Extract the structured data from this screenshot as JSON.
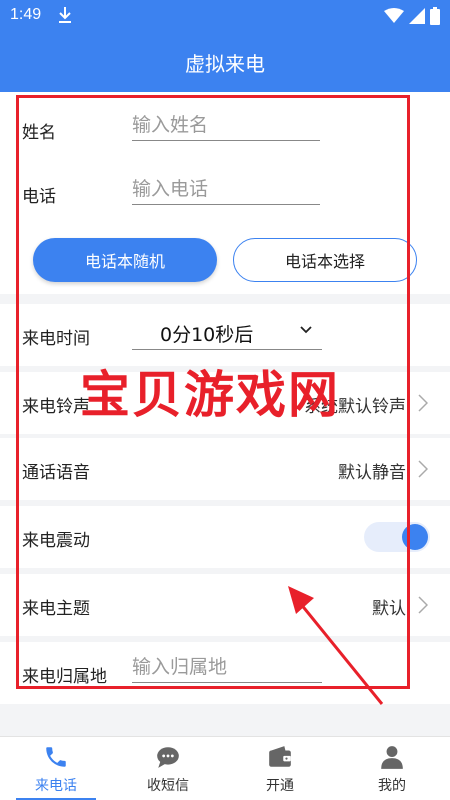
{
  "status": {
    "time": "1:49",
    "icons": [
      "download-icon",
      "wifi-icon",
      "signal-icon",
      "battery-icon"
    ]
  },
  "header": {
    "title": "虚拟来电"
  },
  "form": {
    "name": {
      "label": "姓名",
      "placeholder": "输入姓名"
    },
    "phone": {
      "label": "电话",
      "placeholder": "输入电话"
    },
    "buttons": {
      "random": "电话本随机",
      "choose": "电话本选择"
    },
    "call_time": {
      "label": "来电时间",
      "value": "0分10秒后"
    },
    "ringtone": {
      "label": "来电铃声",
      "value": "系统默认铃声"
    },
    "voice": {
      "label": "通话语音",
      "value": "默认静音"
    },
    "vibrate": {
      "label": "来电震动",
      "on": true
    },
    "theme": {
      "label": "来电主题",
      "value": "默认"
    },
    "location": {
      "label": "来电归属地",
      "placeholder": "输入归属地"
    }
  },
  "tabs": [
    {
      "label": "来电话",
      "icon": "phone-icon",
      "active": true
    },
    {
      "label": "收短信",
      "icon": "message-icon",
      "active": false
    },
    {
      "label": "开通",
      "icon": "wallet-icon",
      "active": false
    },
    {
      "label": "我的",
      "icon": "user-icon",
      "active": false
    }
  ],
  "watermark": "宝贝游戏网",
  "colors": {
    "accent": "#3c82f0",
    "annotation": "#e8202a"
  }
}
